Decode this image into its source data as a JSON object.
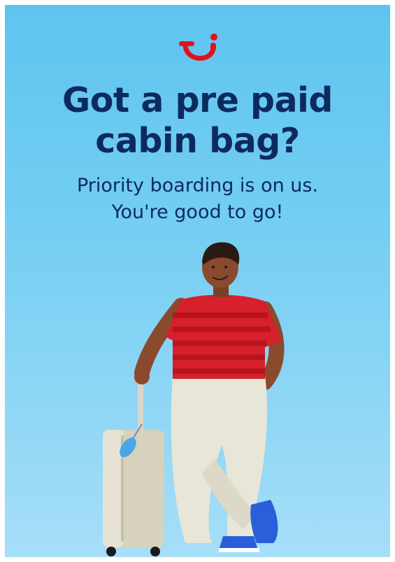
{
  "brand": {
    "logo_icon": "tui-smile-logo-icon",
    "logo_color": "#e2121b"
  },
  "headline": {
    "line1": "Got a pre paid",
    "line2": "cabin bag?"
  },
  "subline": {
    "line1": "Priority boarding is on us.",
    "line2": "You're good to go!"
  },
  "colors": {
    "background_top": "#5ec4ef",
    "background_bottom": "#a6def8",
    "text": "#0d2a5e",
    "shirt": "#d6202b",
    "trousers": "#e8e6d9",
    "shoes": "#2b5fd9"
  },
  "illustration": {
    "icon": "traveller-with-suitcase-illustration"
  }
}
